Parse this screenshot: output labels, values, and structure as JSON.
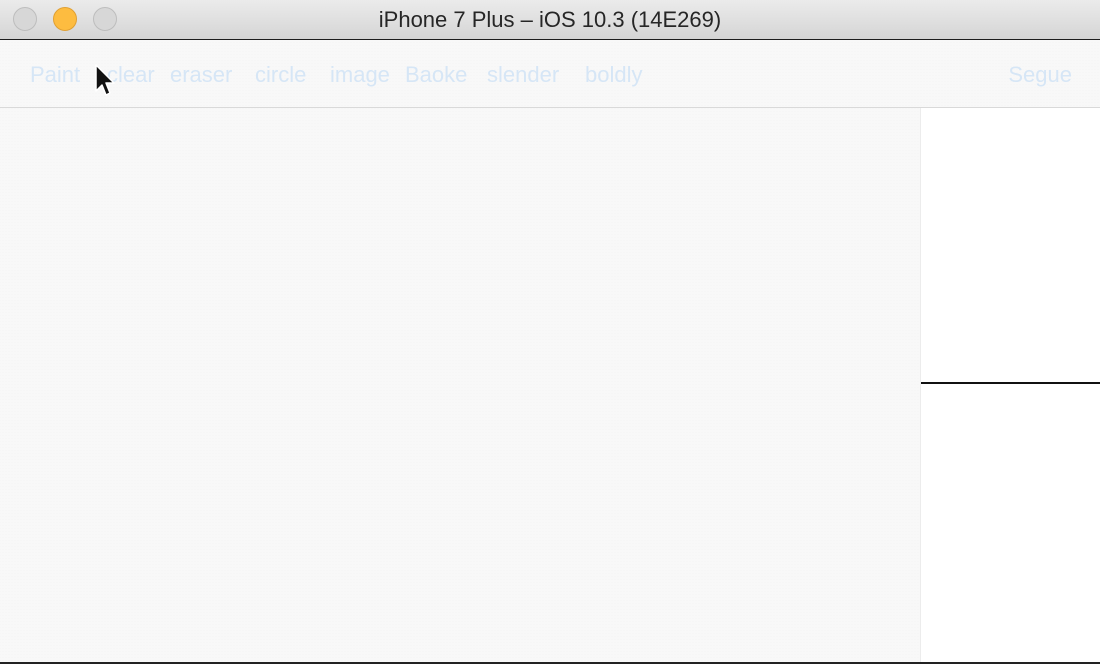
{
  "window": {
    "title": "iPhone 7 Plus – iOS 10.3 (14E269)"
  },
  "toolbar": {
    "items": [
      {
        "label": "Paint"
      },
      {
        "label": "clear"
      },
      {
        "label": "eraser"
      },
      {
        "label": "circle"
      },
      {
        "label": "image"
      },
      {
        "label": "Baoke"
      },
      {
        "label": "slender"
      },
      {
        "label": "boldly"
      }
    ],
    "segue_label": "Segue"
  },
  "colors": {
    "toolbar_text": "#d6e6f6",
    "minimize": "#fdbc40"
  }
}
